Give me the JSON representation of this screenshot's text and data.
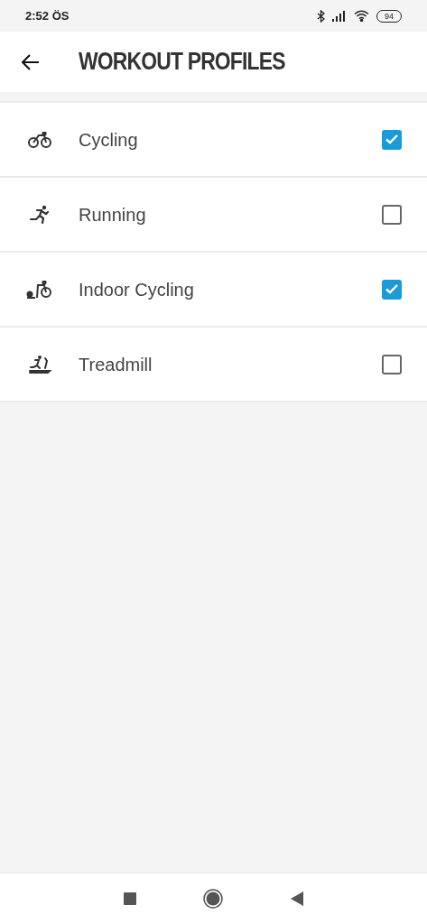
{
  "status_bar": {
    "time": "2:52 ÖS",
    "battery": "94"
  },
  "header": {
    "title": "WORKOUT PROFILES"
  },
  "profiles": [
    {
      "kind": "cycling",
      "label": "Cycling",
      "checked": true
    },
    {
      "kind": "running",
      "label": "Running",
      "checked": false
    },
    {
      "kind": "indoor",
      "label": "Indoor Cycling",
      "checked": true
    },
    {
      "kind": "treadmill",
      "label": "Treadmill",
      "checked": false
    }
  ]
}
